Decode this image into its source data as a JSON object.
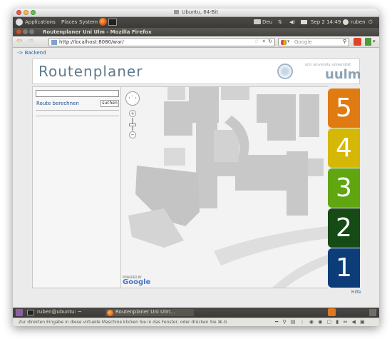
{
  "host_window": {
    "title": "Ubuntu, 64-Bit"
  },
  "top_panel": {
    "menus": [
      "Applications",
      "Places",
      "System"
    ],
    "keyboard": "Deu",
    "datetime": "Sep 2 14:49",
    "user": "ruben"
  },
  "browser": {
    "window_title": "Routenplaner Uni Ulm - Mozilla Firefox",
    "url": "http://localhost:8080/war/",
    "search_placeholder": "Google"
  },
  "page": {
    "backend_link": "-> Backend",
    "app_title": "Routenplaner",
    "logo_small_text": "ulm university universität",
    "logo_text": "uulm",
    "search_value": "",
    "route_link": "Route berechnen",
    "search_button": "suchen",
    "map_attribution_small": "POWERED BY",
    "map_attribution": "Google",
    "help_link": "Hilfe",
    "floors": [
      {
        "label": "5",
        "color": "#e07b12"
      },
      {
        "label": "4",
        "color": "#d5b705"
      },
      {
        "label": "3",
        "color": "#5fa611"
      },
      {
        "label": "2",
        "color": "#164b15"
      },
      {
        "label": "1",
        "color": "#0c3d78"
      }
    ]
  },
  "taskbar": {
    "tasks": [
      "ruben@ubuntu: ~",
      "Routenplaner Uni Ulm..."
    ]
  },
  "vm_status": {
    "hint": "Zur direkten Eingabe in diese virtuelle Maschine klicken Sie in das Fenster, oder drücken Sie ⌘-G"
  },
  "colors": {
    "panel": "#3c3b37",
    "link": "#1f65a6",
    "app_title": "#607a8d",
    "map_building": "#c8c8c8"
  }
}
